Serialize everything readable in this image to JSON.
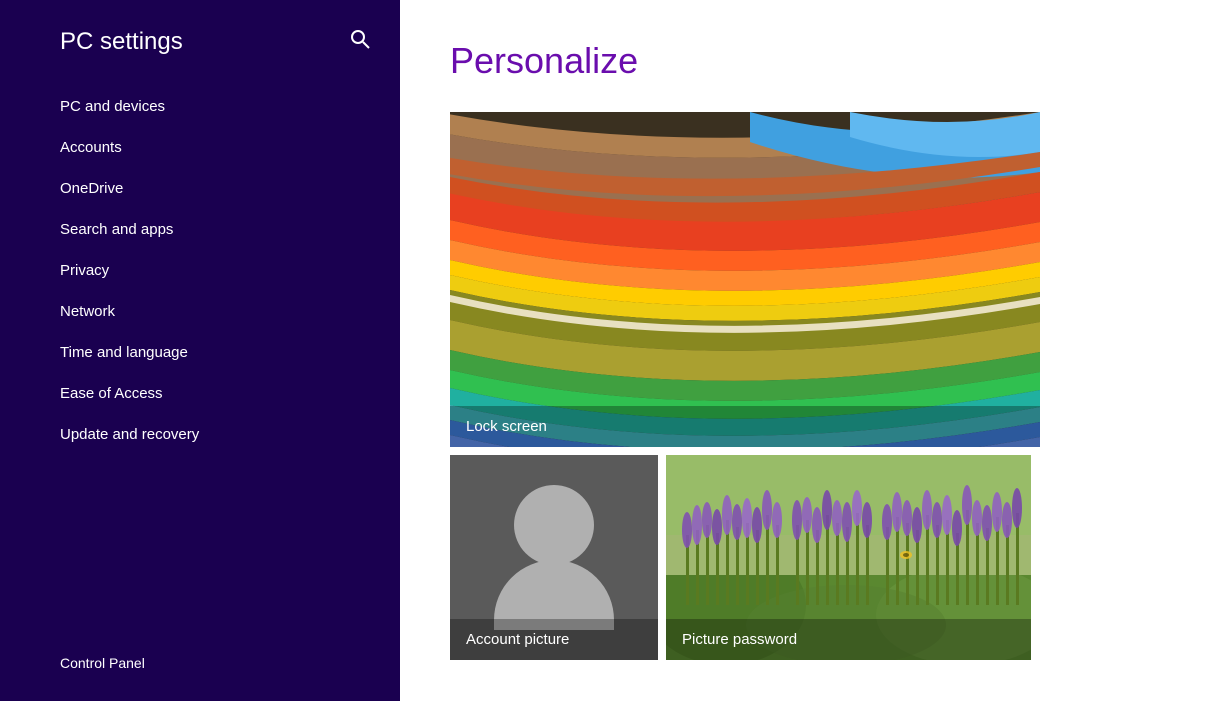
{
  "sidebar": {
    "title": "PC settings",
    "search_icon": "🔍",
    "nav_items": [
      {
        "label": "PC and devices",
        "id": "pc-and-devices"
      },
      {
        "label": "Accounts",
        "id": "accounts"
      },
      {
        "label": "OneDrive",
        "id": "onedrive"
      },
      {
        "label": "Search and apps",
        "id": "search-and-apps"
      },
      {
        "label": "Privacy",
        "id": "privacy"
      },
      {
        "label": "Network",
        "id": "network"
      },
      {
        "label": "Time and language",
        "id": "time-and-language"
      },
      {
        "label": "Ease of Access",
        "id": "ease-of-access"
      },
      {
        "label": "Update and recovery",
        "id": "update-and-recovery"
      }
    ],
    "footer_items": [
      {
        "label": "Control Panel",
        "id": "control-panel"
      }
    ]
  },
  "main": {
    "title": "Personalize",
    "tiles": [
      {
        "label": "Lock screen",
        "id": "lock-screen"
      },
      {
        "label": "Account picture",
        "id": "account-picture"
      },
      {
        "label": "Picture password",
        "id": "picture-password"
      }
    ]
  }
}
